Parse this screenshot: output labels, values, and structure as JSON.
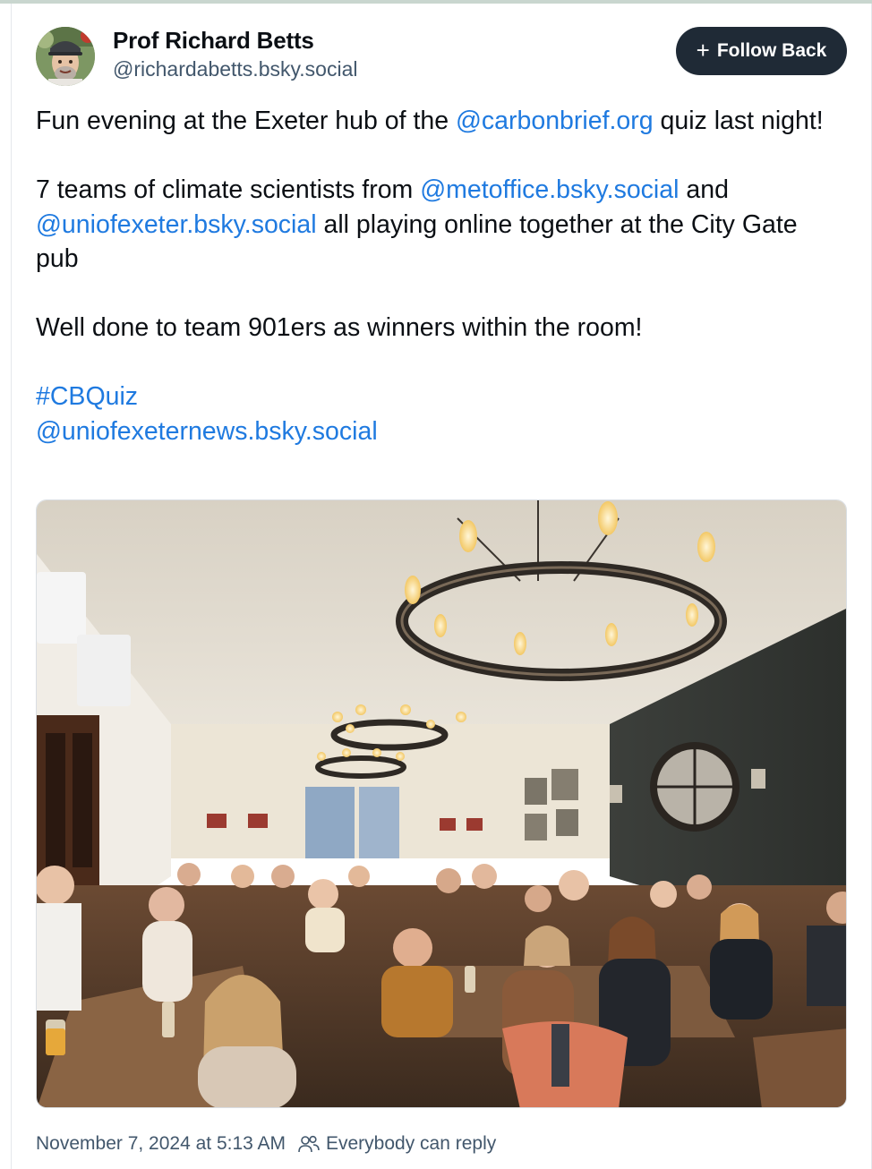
{
  "post": {
    "author": {
      "display_name": "Prof Richard Betts",
      "handle": "@richardabetts.bsky.social"
    },
    "follow_button": {
      "icon": "plus-icon",
      "label": "Follow Back"
    },
    "text": {
      "l1_a": "Fun evening at the Exeter hub of the ",
      "l1_mention": "@carbonbrief.org",
      "l1_b": " quiz last night!",
      "l2_a": "7 teams of climate scientists from ",
      "l2_mention1": "@metoffice.bsky.social",
      "l2_b": " and ",
      "l2_mention2": "@uniofexeter.bsky.social",
      "l2_c": " all playing online together at the City Gate pub",
      "l3": "Well done to team 901ers as winners within the room!",
      "hashtag": "#CBQuiz",
      "mention_last": "@uniofexeternews.bsky.social"
    },
    "image": {
      "subject": "group-photo-pub"
    },
    "footer": {
      "timestamp": "November 7, 2024 at 5:13 AM",
      "reply_icon": "people-icon",
      "reply_setting": "Everybody can reply"
    }
  },
  "colors": {
    "link": "#1f7ae0",
    "follow_button_bg": "#1f2a36",
    "muted_text": "#42576c"
  }
}
